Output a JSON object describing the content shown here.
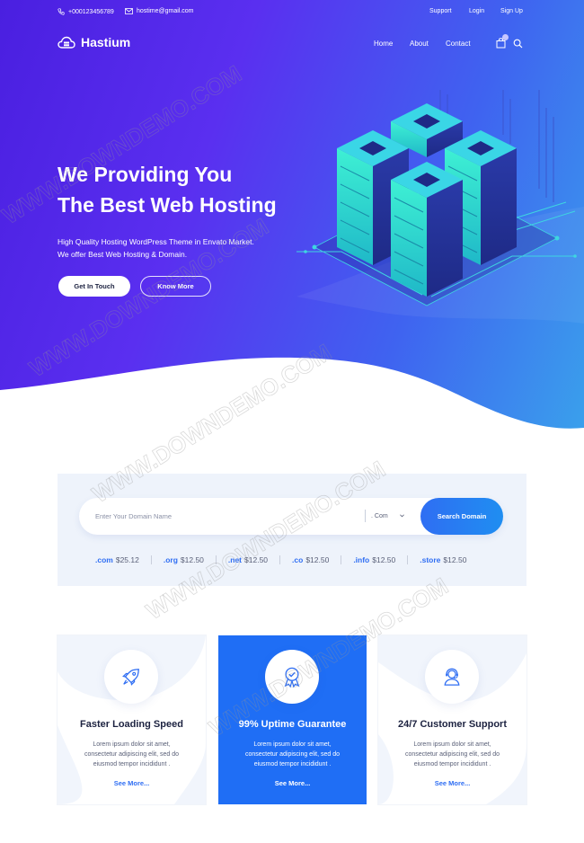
{
  "topbar": {
    "phone": "+000123456789",
    "email": "hostime@gmail.com",
    "links": [
      "Support",
      "Login",
      "Sign Up"
    ]
  },
  "nav": {
    "brand": "Hastium",
    "links": [
      "Home",
      "About",
      "Contact"
    ]
  },
  "hero": {
    "title_line1": "We Providing You",
    "title_line2": "The Best Web Hosting",
    "subtitle_line1": "High Quality Hosting WordPress Theme in Envato Market.",
    "subtitle_line2": "We offer Best Web Hosting & Domain.",
    "primary_button": "Get In Touch",
    "secondary_button": "Know More"
  },
  "domain_search": {
    "placeholder": "Enter Your Domain Name",
    "tld_selected": ". Com",
    "button": "Search Domain",
    "prices": [
      {
        "tld": ".com",
        "price": "$25.12"
      },
      {
        "tld": ".org",
        "price": "$12.50"
      },
      {
        "tld": ".net",
        "price": "$12.50"
      },
      {
        "tld": ".co",
        "price": "$12.50"
      },
      {
        "tld": ".info",
        "price": "$12.50"
      },
      {
        "tld": ".store",
        "price": "$12.50"
      }
    ]
  },
  "features": [
    {
      "icon": "rocket-icon",
      "title": "Faster Loading Speed",
      "text_line1": "Lorem ipsum dolor sit amet,",
      "text_line2": "consectetur adipiscing elit, sed do",
      "text_line3": "eiusmod tempor incididunt .",
      "more": "See More..."
    },
    {
      "icon": "badge-check-icon",
      "title": "99% Uptime Guarantee",
      "text_line1": "Lorem ipsum dolor sit amet,",
      "text_line2": "consectetur adipiscing elit, sed do",
      "text_line3": "eiusmod tempor incididunt .",
      "more": "See More..."
    },
    {
      "icon": "support-agent-icon",
      "title": "24/7 Customer Support",
      "text_line1": "Lorem ipsum dolor sit amet,",
      "text_line2": "consectetur adipiscing elit, sed do",
      "text_line3": "eiusmod tempor incididunt .",
      "more": "See More..."
    }
  ],
  "watermark": "WWW.DOWNDEMO.COM",
  "colors": {
    "hero_start": "#4a1fe0",
    "hero_end": "#3aa0ec",
    "accent": "#2f6ef3",
    "active_card": "#1f6ef5",
    "domain_bg": "#eef3fb"
  }
}
